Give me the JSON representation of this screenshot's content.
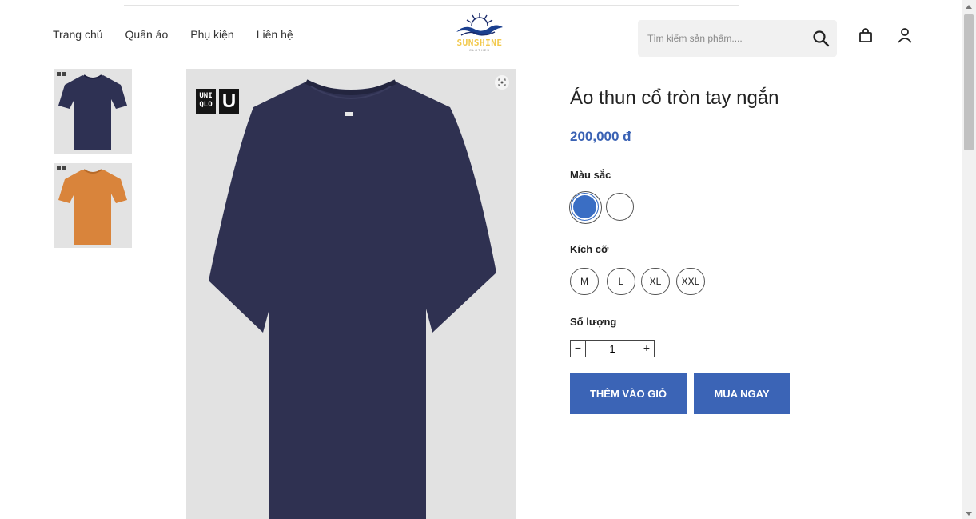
{
  "header": {
    "nav": [
      "Trang chủ",
      "Quần áo",
      "Phụ kiện",
      "Liên hệ"
    ],
    "logo": {
      "brand": "SUNSHINE",
      "sub": "CLOTHES"
    },
    "search": {
      "placeholder": "Tìm kiếm sản phẩm...."
    },
    "icons": [
      "search-icon",
      "shopping-bag-icon",
      "user-icon"
    ]
  },
  "gallery": {
    "thumbnails": [
      {
        "color_name": "navy",
        "color": "#2e3153"
      },
      {
        "color_name": "orange",
        "color": "#d9843b"
      }
    ],
    "main_image": {
      "brand_badge_left": "UNI QLO",
      "brand_badge_right": "U",
      "shirt_color": "#2f3151"
    }
  },
  "product": {
    "title": "Áo thun cổ tròn tay ngắn",
    "price": "200,000 đ",
    "color_label": "Màu sắc",
    "colors": [
      {
        "value": "#3a6ec4",
        "selected": true
      },
      {
        "value": "#ffffff",
        "selected": false
      }
    ],
    "size_label": "Kích cỡ",
    "sizes": [
      "M",
      "L",
      "XL",
      "XXL"
    ],
    "quantity_label": "Số lượng",
    "quantity": "1",
    "minus": "−",
    "plus": "+",
    "add_to_cart": "THÊM VÀO GIỎ",
    "buy_now": "MUA NGAY"
  },
  "colors": {
    "accent": "#3b64b6",
    "price": "#3a62b4",
    "logo_yellow": "#f2c94c"
  }
}
